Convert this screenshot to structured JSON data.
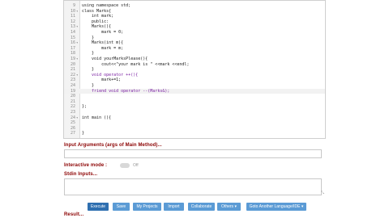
{
  "editor": {
    "lines": [
      {
        "n": "9",
        "fold": "",
        "text": "using namespace std;",
        "kw": false
      },
      {
        "n": "10",
        "fold": "▾",
        "text": "class Marks{",
        "kw": false
      },
      {
        "n": "11",
        "fold": "",
        "text": "    int mark;",
        "kw": false
      },
      {
        "n": "12",
        "fold": "",
        "text": "    public:",
        "kw": false
      },
      {
        "n": "13",
        "fold": "▾",
        "text": "    Marks(){",
        "kw": false
      },
      {
        "n": "14",
        "fold": "",
        "text": "        mark = 0;",
        "kw": false
      },
      {
        "n": "15",
        "fold": "",
        "text": "    }",
        "kw": false
      },
      {
        "n": "16",
        "fold": "▾",
        "text": "    Marks(int m){",
        "kw": false
      },
      {
        "n": "17",
        "fold": "",
        "text": "        mark = m;",
        "kw": false
      },
      {
        "n": "18",
        "fold": "",
        "text": "    }",
        "kw": false
      },
      {
        "n": "19",
        "fold": "▾",
        "text": "    void yourMarksPlease(){",
        "kw": false
      },
      {
        "n": "20",
        "fold": "",
        "text": "        cout<<\"your mark is \" <<mark <<endl;",
        "kw": false
      },
      {
        "n": "21",
        "fold": "",
        "text": "    }",
        "kw": false
      },
      {
        "n": "22",
        "fold": "▾",
        "text": "    void operator ++(){",
        "kw": true
      },
      {
        "n": "23",
        "fold": "",
        "text": "        mark+=1;",
        "kw": false
      },
      {
        "n": "24",
        "fold": "",
        "text": "    }",
        "kw": false
      },
      {
        "n": "19",
        "fold": "",
        "text": "    friend void operator --(Marks&);",
        "kw": true
      },
      {
        "n": "20",
        "fold": "",
        "text": "",
        "kw": false
      },
      {
        "n": "21",
        "fold": "",
        "text": "",
        "kw": false
      },
      {
        "n": "22",
        "fold": "",
        "text": "};",
        "kw": false
      },
      {
        "n": "23",
        "fold": "",
        "text": "",
        "kw": false
      },
      {
        "n": "24",
        "fold": "▾",
        "text": "int main (){",
        "kw": false
      },
      {
        "n": "25",
        "fold": "",
        "text": "",
        "kw": false
      },
      {
        "n": "26",
        "fold": "",
        "text": "",
        "kw": false
      },
      {
        "n": "27",
        "fold": "",
        "text": "}",
        "kw": false
      }
    ]
  },
  "labels": {
    "input_arguments": "Input Arguments (args of Main Method)...",
    "interactive_mode": "Interactive mode :",
    "toggle_state": "Off",
    "stdin": "Stdin Inputs...",
    "result": "Result..."
  },
  "buttons": [
    {
      "label": "Execute",
      "primary": true
    },
    {
      "label": "Save",
      "primary": false
    },
    {
      "label": "My Projects",
      "primary": false
    },
    {
      "label": "Import",
      "primary": false
    },
    {
      "label": "Collaborate",
      "primary": false
    },
    {
      "label": "Others ▾",
      "primary": false
    },
    {
      "label": "Goto Another Language/IDE ▾",
      "primary": false
    }
  ],
  "colors": {
    "label_red": "#8b0000",
    "button_blue": "#5b9bd5",
    "keyword_purple": "#7a1fa2"
  }
}
